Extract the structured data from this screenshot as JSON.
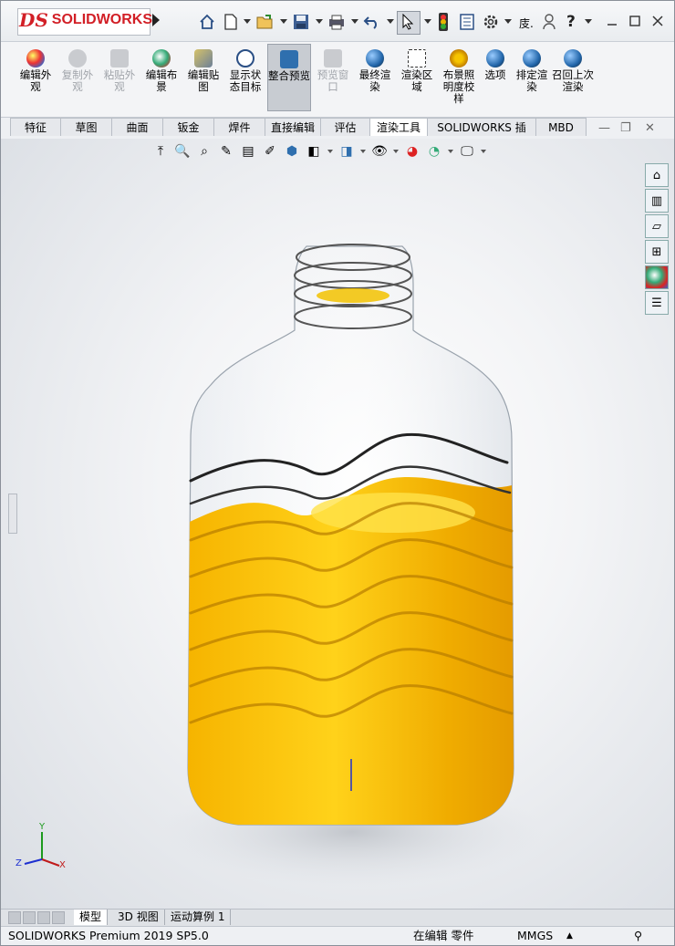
{
  "app": {
    "logo_ds": "DS",
    "logo_text": "SOLIDWORKS",
    "brand_color": "#d21f26"
  },
  "titlebar": {
    "icons": [
      "home-icon",
      "new-doc-icon",
      "open-icon",
      "save-icon",
      "print-icon",
      "undo-icon",
      "select-cursor-icon",
      "traffic-light-icon",
      "file-properties-icon",
      "options-gear-icon"
    ],
    "search_fragment": "庋.",
    "window_controls": [
      "minimize-icon",
      "restore-icon",
      "close-icon"
    ]
  },
  "commands": [
    {
      "label": "编辑外观",
      "enabled": true
    },
    {
      "label": "复制外观",
      "enabled": false
    },
    {
      "label": "粘贴外观",
      "enabled": false
    },
    {
      "label": "编辑布景",
      "enabled": true
    },
    {
      "label": "编辑贴图",
      "enabled": true
    },
    {
      "label": "显示状态目标",
      "enabled": true
    },
    {
      "label": "整合预览",
      "enabled": true,
      "selected": true
    },
    {
      "label": "预览窗口",
      "enabled": false
    },
    {
      "label": "最终渲染",
      "enabled": true
    },
    {
      "label": "渲染区域",
      "enabled": true
    },
    {
      "label": "布景照明度校样",
      "enabled": true
    },
    {
      "label": "选项",
      "enabled": true
    },
    {
      "label": "排定渲染",
      "enabled": true
    },
    {
      "label": "召回上次渲染",
      "enabled": true
    }
  ],
  "tabs": [
    "特征",
    "草图",
    "曲面",
    "钣金",
    "焊件",
    "直接编辑",
    "评估",
    "渲染工具",
    "SOLIDWORKS 插件",
    "MBD"
  ],
  "active_tab": "渲染工具",
  "bottom_tabs": [
    "模型",
    "3D 视图",
    "运动算例 1"
  ],
  "active_bottom_tab": "模型",
  "status": {
    "product": "SOLIDWORKS Premium 2019 SP5.0",
    "mode": "在编辑 零件",
    "units": "MMGS"
  },
  "triad": {
    "x": "X",
    "y": "Y",
    "z": "Z"
  },
  "model": {
    "liquid_color": "#f3b300",
    "bottle": "transparent PET bottle with wavy ribs"
  }
}
